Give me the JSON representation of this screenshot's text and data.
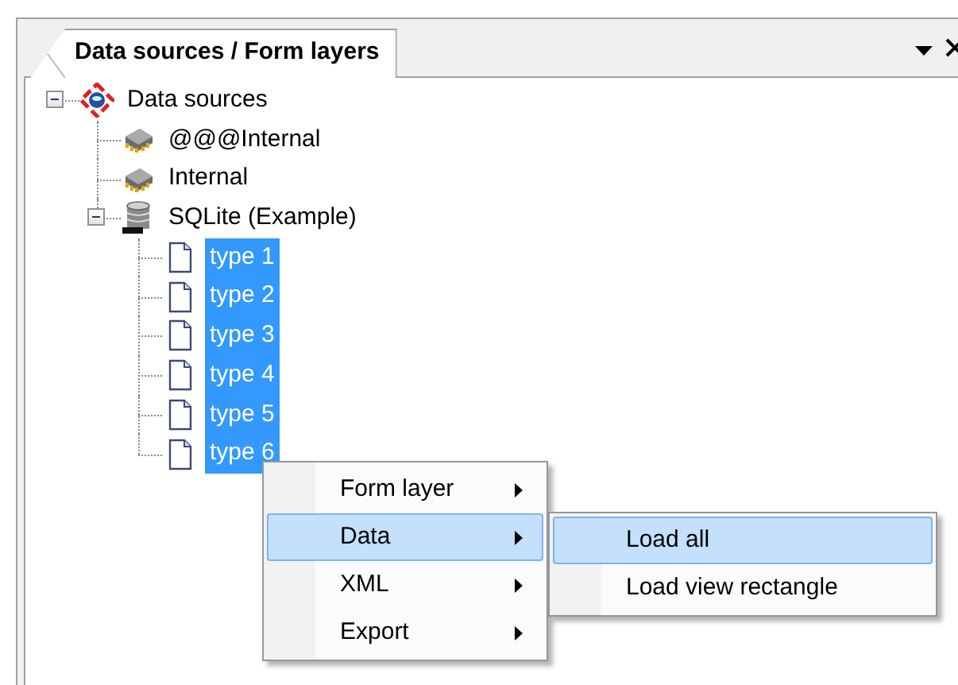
{
  "panel": {
    "tab": {
      "label": "Data sources / Form layers",
      "selected": true
    }
  },
  "tree": [
    {
      "label": "Data sources",
      "kind": "datasource",
      "selected": false,
      "expanded": true,
      "children": [
        {
          "label": "@@@Internal",
          "kind": "chip",
          "selected": false
        },
        {
          "label": "Internal",
          "kind": "chip",
          "selected": false
        },
        {
          "label": "SQLite (Example)",
          "kind": "database",
          "selected": false,
          "expanded": true,
          "children": [
            {
              "label": "type 1",
              "kind": "document",
              "selected": true
            },
            {
              "label": "type 2",
              "kind": "document",
              "selected": true
            },
            {
              "label": "type 3",
              "kind": "document",
              "selected": true
            },
            {
              "label": "type 4",
              "kind": "document",
              "selected": true
            },
            {
              "label": "type 5",
              "kind": "document",
              "selected": true
            },
            {
              "label": "type 6",
              "kind": "document",
              "selected": true
            }
          ]
        }
      ]
    }
  ],
  "context_menu": {
    "items": [
      {
        "label": "Form layer",
        "submenu": true,
        "selected": false
      },
      {
        "label": "Data",
        "submenu": true,
        "selected": true
      },
      {
        "label": "XML",
        "submenu": true,
        "selected": false
      },
      {
        "label": "Export",
        "submenu": true,
        "selected": false
      }
    ]
  },
  "submenu": {
    "items": [
      {
        "label": "Load all",
        "selected": true
      },
      {
        "label": "Load view rectangle",
        "selected": false
      }
    ]
  }
}
